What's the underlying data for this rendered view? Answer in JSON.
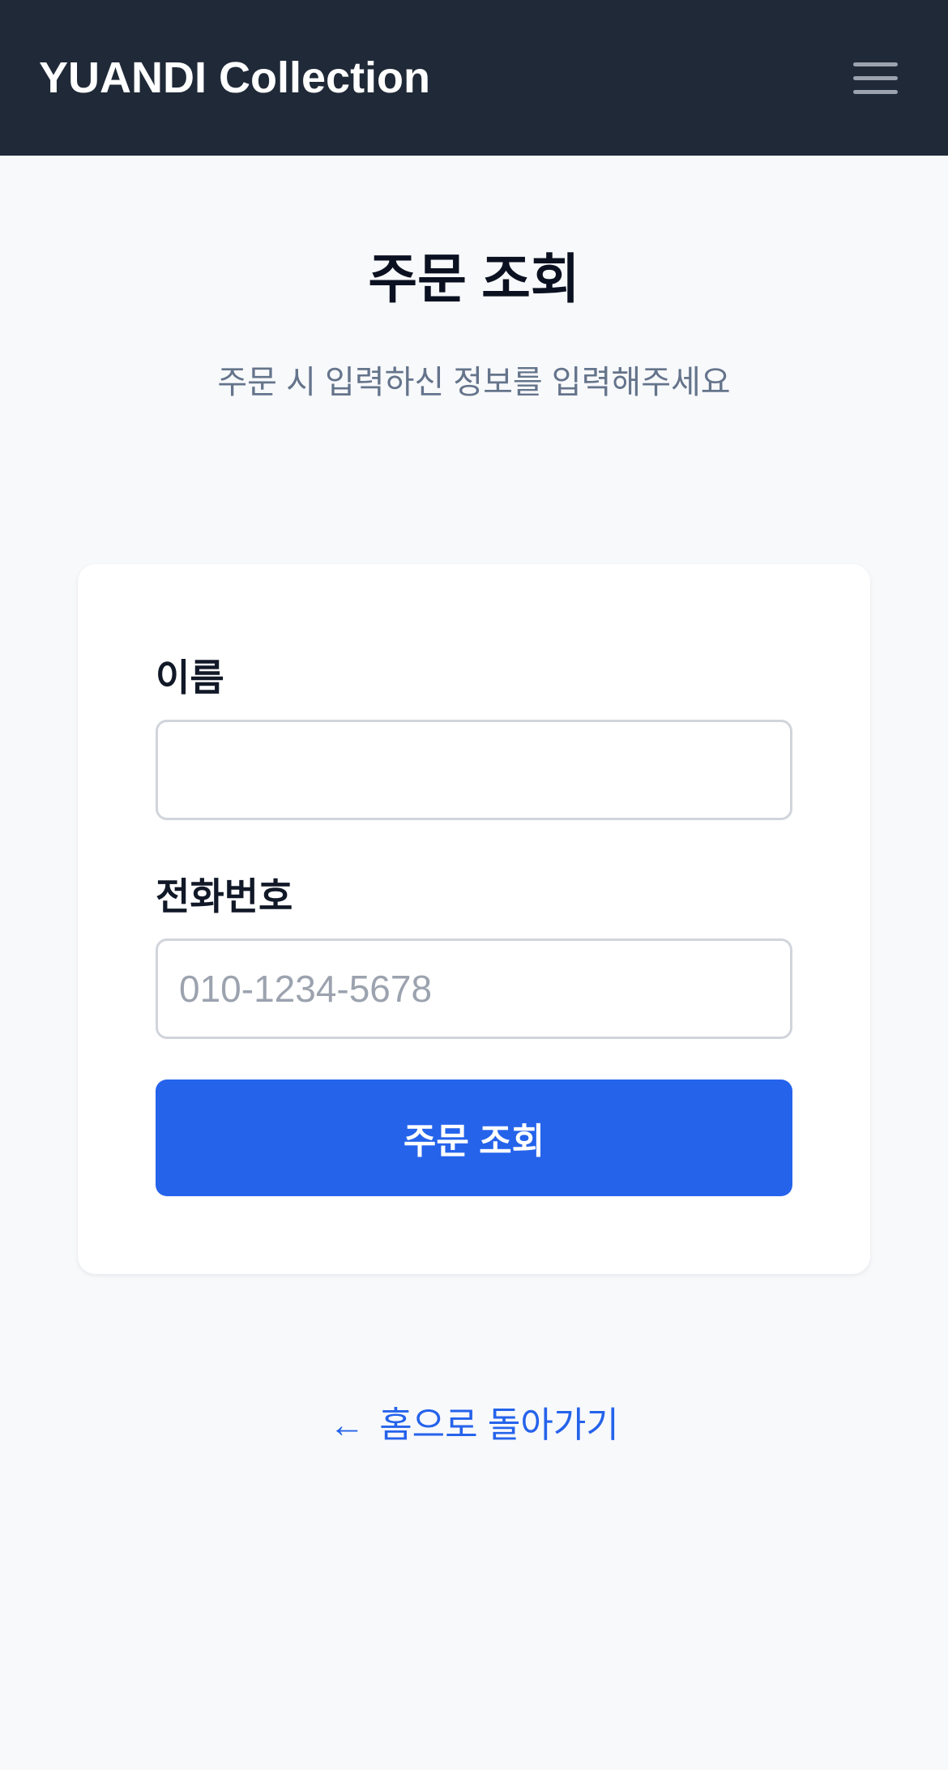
{
  "header": {
    "brand": "YUANDI Collection",
    "menu_icon": "hamburger-menu-icon"
  },
  "page": {
    "title": "주문 조회",
    "subtitle": "주문 시 입력하신 정보를 입력해주세요"
  },
  "form": {
    "name_label": "이름",
    "name_value": "",
    "name_placeholder": "",
    "phone_label": "전화번호",
    "phone_value": "",
    "phone_placeholder": "010-1234-5678",
    "submit_label": "주문 조회"
  },
  "footer": {
    "back_arrow": "←",
    "back_label": "홈으로 돌아가기"
  },
  "colors": {
    "header_bg": "#1f2937",
    "accent": "#2563eb",
    "page_bg": "#f8f9fb"
  }
}
